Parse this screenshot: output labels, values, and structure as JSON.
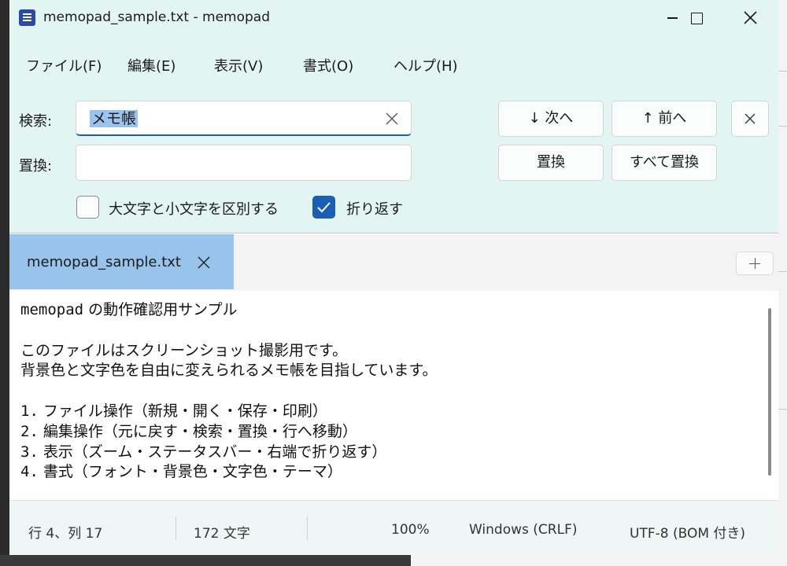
{
  "window": {
    "title": "memopad_sample.txt - memopad"
  },
  "menu": {
    "items": [
      "ファイル(F)",
      "編集(E)",
      "表示(V)",
      "書式(O)",
      "ヘルプ(H)"
    ]
  },
  "find": {
    "search_label": "検索:",
    "search_value": "メモ帳",
    "replace_label": "置換:",
    "replace_value": "",
    "next_label": "↓ 次へ",
    "prev_label": "↑ 前へ",
    "replace_button": "置換",
    "replace_all_button": "すべて置換",
    "close_icon": "close-icon",
    "match_case_label": "大文字と小文字を区別する",
    "match_case_checked": false,
    "wrap_label": "折り返す",
    "wrap_checked": true
  },
  "tabs": [
    {
      "label": "memopad_sample.txt",
      "active": true
    }
  ],
  "editor": {
    "lines": [
      {
        "mono": "memopad",
        "text": " の動作確認用サンプル"
      },
      {
        "mono": "",
        "text": ""
      },
      {
        "mono": "",
        "text": "このファイルはスクリーンショット撮影用です。"
      },
      {
        "mono": "",
        "text": "背景色と文字色を自由に変えられるメモ帳を目指しています。"
      },
      {
        "mono": "",
        "text": ""
      },
      {
        "mono": "1.",
        "text": " ファイル操作（新規・開く・保存・印刷）"
      },
      {
        "mono": "2.",
        "text": " 編集操作（元に戻す・検索・置換・行へ移動）"
      },
      {
        "mono": "3.",
        "text": " 表示（ズーム・ステータスバー・右端で折り返す）"
      },
      {
        "mono": "4.",
        "text": " 書式（フォント・背景色・文字色・テーマ）"
      }
    ]
  },
  "status": {
    "position": "行 4、列 17",
    "chars": "172 文字",
    "zoom": "100%",
    "line_ending": "Windows (CRLF)",
    "encoding": "UTF-8 (BOM 付き)"
  },
  "colors": {
    "chrome_bg": "#e3f5f2",
    "accent": "#1b5fb5",
    "active_tab": "#98c4ec",
    "selection": "#9cc3ec"
  }
}
